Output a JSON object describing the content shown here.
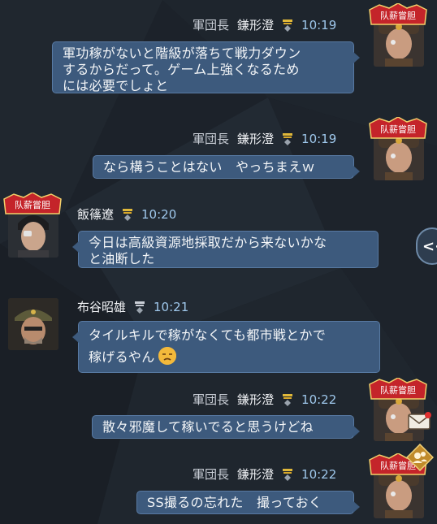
{
  "messages": [
    {
      "role": "軍団長",
      "name": "鎌形澄",
      "time": "10:19",
      "side": "right",
      "badge": "队薪嘗胆",
      "lines": [
        "軍功稼がないと階級が落ちて戦力ダウン",
        "するからだって。ゲーム上強くなるため",
        "には必要でしょと"
      ]
    },
    {
      "role": "軍団長",
      "name": "鎌形澄",
      "time": "10:19",
      "side": "right",
      "badge": "队薪嘗胆",
      "lines": [
        "なら構うことはない　やっちまえｗ"
      ]
    },
    {
      "role": "",
      "name": "飯篠遼",
      "time": "10:20",
      "side": "left",
      "badge": "队薪嘗胆",
      "lines": [
        "今日は高級資源地採取だから来ないかな",
        "と油断した"
      ]
    },
    {
      "role": "",
      "name": "布谷昭雄",
      "time": "10:21",
      "side": "left",
      "badge": "",
      "lines": [
        "タイルキルで稼がなくても都市戦とかで",
        "稼げるやん"
      ]
    },
    {
      "role": "軍団長",
      "name": "鎌形澄",
      "time": "10:22",
      "side": "right",
      "badge": "队薪嘗胆",
      "lines": [
        "散々邪魔して稼いでると思うけどね"
      ]
    },
    {
      "role": "軍団長",
      "name": "鎌形澄",
      "time": "10:22",
      "side": "right",
      "badge": "队薪嘗胆",
      "lines": [
        "SS撮るの忘れた　撮っておく"
      ]
    }
  ],
  "side_button": {
    "label": "<<",
    "icon": "collapse-arrows-icon"
  },
  "icons": {
    "mail": "envelope-icon",
    "alliance": "alliance-icon"
  },
  "colors": {
    "bubble": "#3d5a7d",
    "time": "#9fc8ec",
    "background": "#1b2129",
    "badge_red": "#c4242a"
  }
}
